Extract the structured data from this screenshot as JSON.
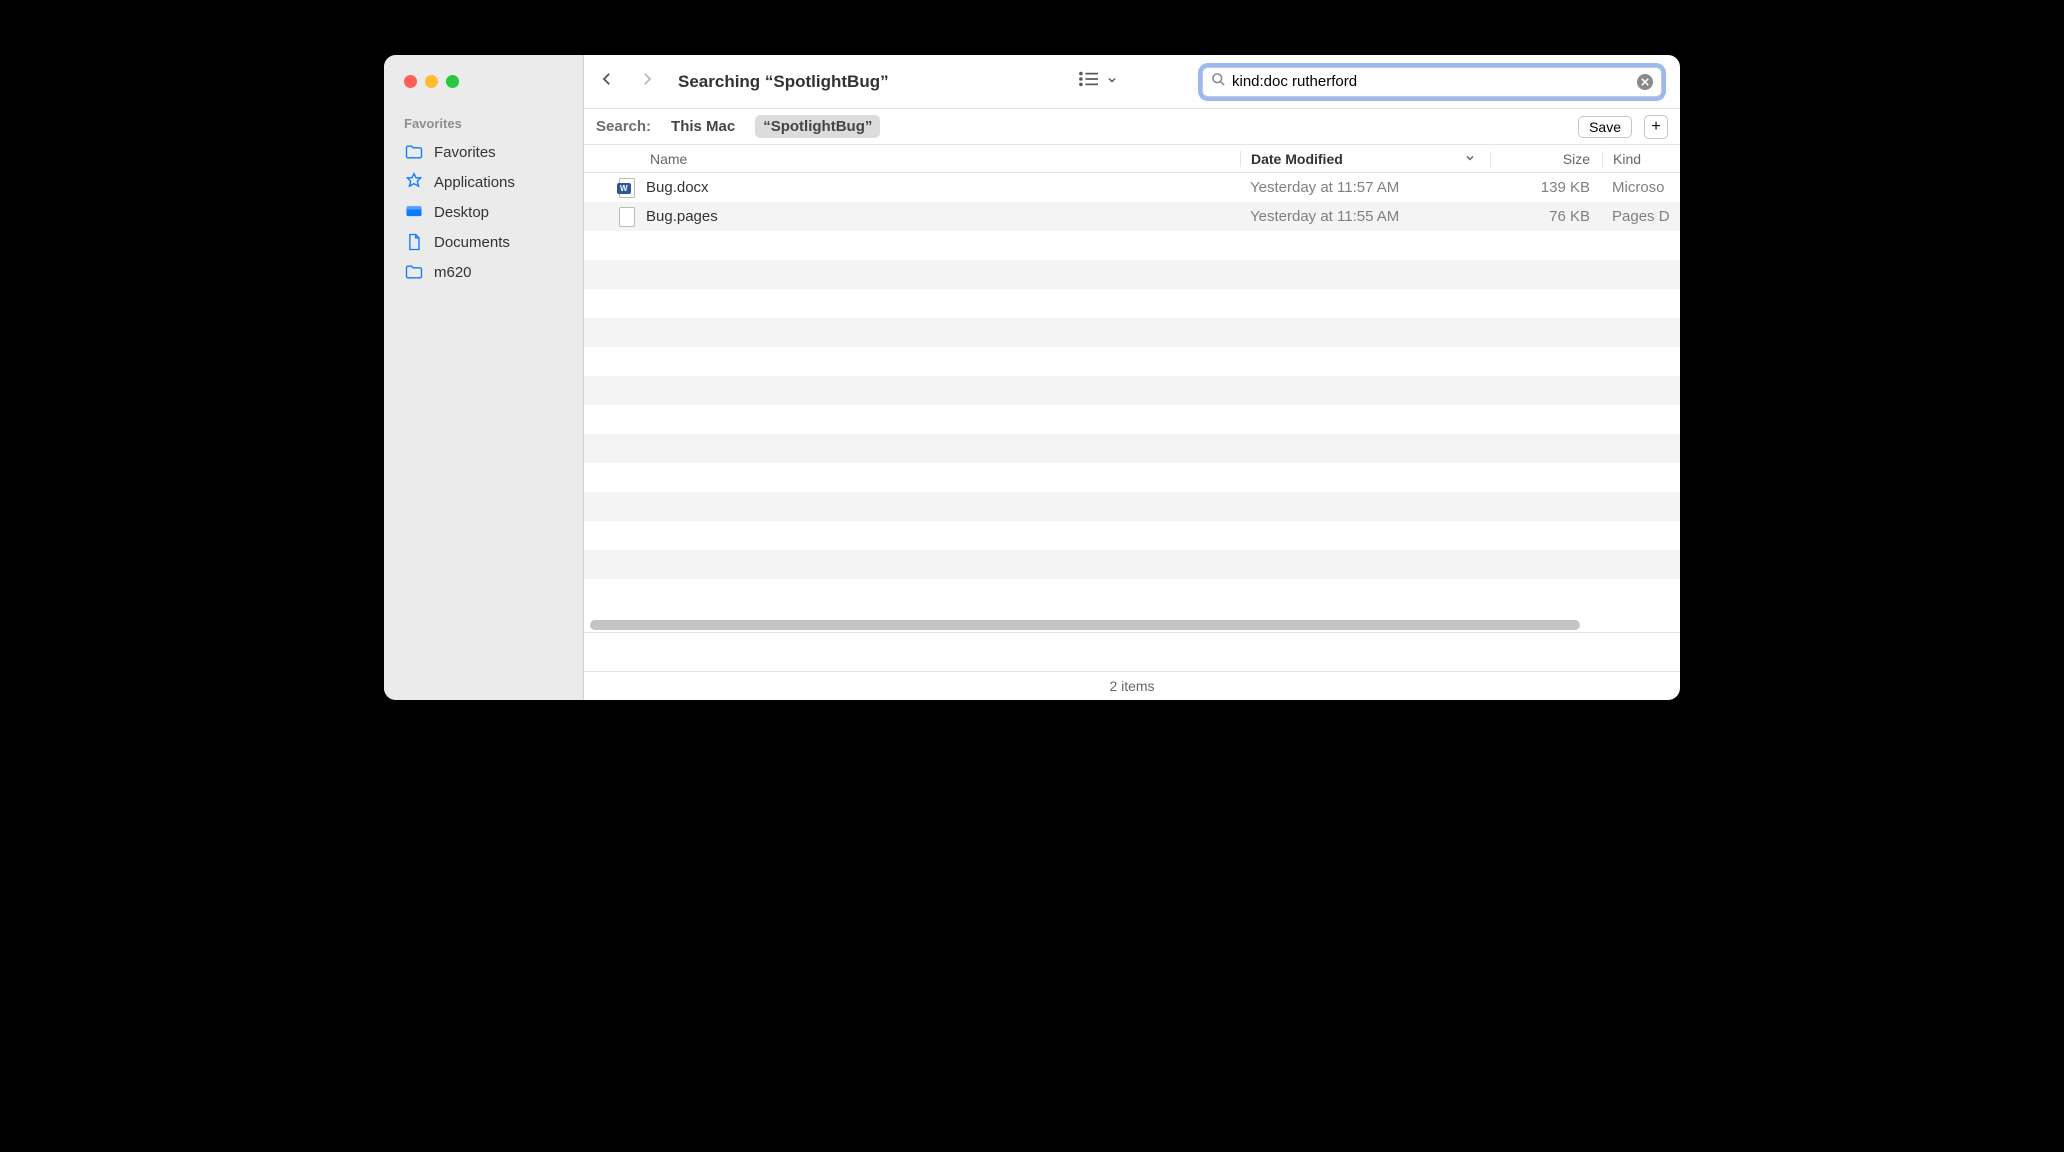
{
  "window": {
    "title": "Searching “SpotlightBug”"
  },
  "search": {
    "query": "kind:doc rutherford"
  },
  "sidebar": {
    "section": "Favorites",
    "items": [
      {
        "label": "Favorites",
        "icon": "folder"
      },
      {
        "label": "Applications",
        "icon": "app"
      },
      {
        "label": "Desktop",
        "icon": "desktop"
      },
      {
        "label": "Documents",
        "icon": "document"
      },
      {
        "label": "m620",
        "icon": "folder"
      }
    ]
  },
  "scope": {
    "label": "Search:",
    "options": [
      {
        "label": "This Mac",
        "active": false
      },
      {
        "label": "“SpotlightBug”",
        "active": true
      }
    ],
    "save": "Save"
  },
  "columns": {
    "name": "Name",
    "date": "Date Modified",
    "size": "Size",
    "kind": "Kind"
  },
  "rows": [
    {
      "name": "Bug.docx",
      "date": "Yesterday at 11:57 AM",
      "size": "139 KB",
      "kind": "Microso",
      "icon": "docx"
    },
    {
      "name": "Bug.pages",
      "date": "Yesterday at 11:55 AM",
      "size": "76 KB",
      "kind": "Pages D",
      "icon": "blank"
    }
  ],
  "status": "2 items"
}
